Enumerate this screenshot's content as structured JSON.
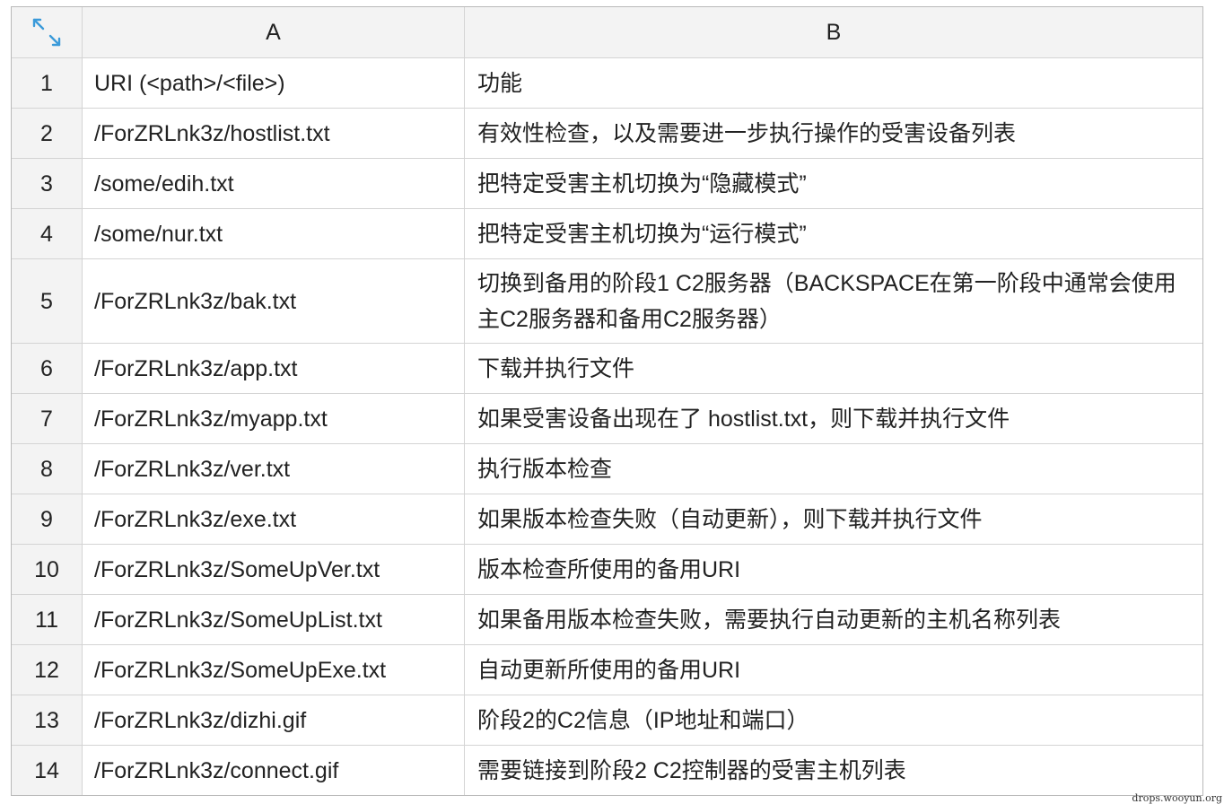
{
  "header": {
    "corner_icon": "expand-icon",
    "col_a": "A",
    "col_b": "B"
  },
  "rows": [
    {
      "num": "1",
      "a": "URI (<path>/<file>)",
      "b": "功能"
    },
    {
      "num": "2",
      "a": "/ForZRLnk3z/hostlist.txt",
      "b": "有效性检查，以及需要进一步执行操作的受害设备列表"
    },
    {
      "num": "3",
      "a": "/some/edih.txt",
      "b": "把特定受害主机切换为“隐藏模式”"
    },
    {
      "num": "4",
      "a": "/some/nur.txt",
      "b": "把特定受害主机切换为“运行模式”"
    },
    {
      "num": "5",
      "a": "/ForZRLnk3z/bak.txt",
      "b": "切换到备用的阶段1 C2服务器（BACKSPACE在第一阶段中通常会使用主C2服务器和备用C2服务器）"
    },
    {
      "num": "6",
      "a": "/ForZRLnk3z/app.txt",
      "b": "下载并执行文件"
    },
    {
      "num": "7",
      "a": "/ForZRLnk3z/myapp.txt",
      "b": "如果受害设备出现在了 hostlist.txt，则下载并执行文件"
    },
    {
      "num": "8",
      "a": "/ForZRLnk3z/ver.txt",
      "b": "执行版本检查"
    },
    {
      "num": "9",
      "a": "/ForZRLnk3z/exe.txt",
      "b": "如果版本检查失败（自动更新），则下载并执行文件"
    },
    {
      "num": "10",
      "a": "/ForZRLnk3z/SomeUpVer.txt",
      "b": "版本检查所使用的备用URI"
    },
    {
      "num": "11",
      "a": "/ForZRLnk3z/SomeUpList.txt",
      "b": "如果备用版本检查失败，需要执行自动更新的主机名称列表"
    },
    {
      "num": "12",
      "a": "/ForZRLnk3z/SomeUpExe.txt",
      "b": "自动更新所使用的备用URI"
    },
    {
      "num": "13",
      "a": "/ForZRLnk3z/dizhi.gif",
      "b": "阶段2的C2信息（IP地址和端口）"
    },
    {
      "num": "14",
      "a": "/ForZRLnk3z/connect.gif",
      "b": "需要链接到阶段2 C2控制器的受害主机列表"
    }
  ],
  "watermark": "drops.wooyun.org",
  "colors": {
    "accent": "#3a9ad9",
    "header_bg": "#f3f3f3",
    "grid": "#d4d4d4"
  }
}
